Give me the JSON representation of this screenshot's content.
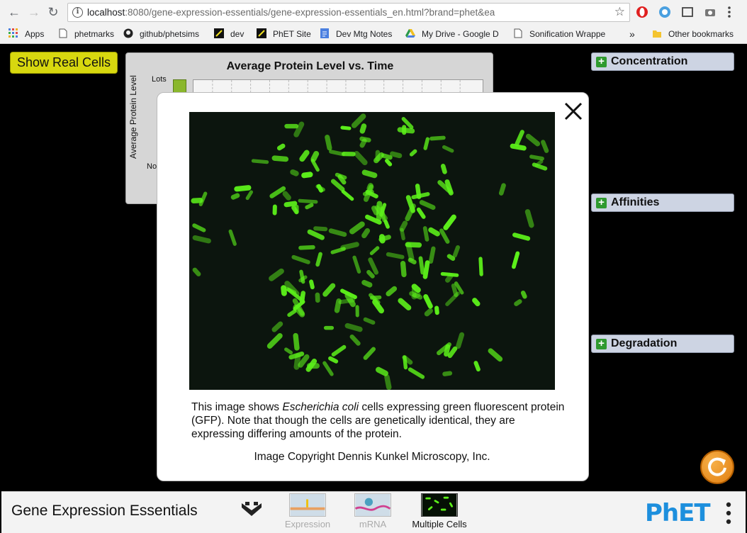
{
  "browser": {
    "url_host": "localhost",
    "url_rest": ":8080/gene-expression-essentials/gene-expression-essentials_en.html?brand=phet&ea",
    "bookmarks": [
      {
        "label": "Apps",
        "icon": "apps-grid-icon"
      },
      {
        "label": "phetmarks",
        "icon": "page-icon"
      },
      {
        "label": "github/phetsims",
        "icon": "github-icon"
      },
      {
        "label": "dev",
        "icon": "phet-icon"
      },
      {
        "label": "PhET Site",
        "icon": "phet-icon"
      },
      {
        "label": "Dev Mtg Notes",
        "icon": "docs-icon"
      },
      {
        "label": "My Drive - Google D",
        "icon": "drive-icon"
      },
      {
        "label": "Sonification Wrappe",
        "icon": "page-icon"
      }
    ],
    "overflow": "»",
    "other_bookmarks": "Other bookmarks"
  },
  "sim": {
    "show_real_cells": "Show Real Cells",
    "chart": {
      "title": "Average Protein Level vs. Time",
      "ylabel": "Average Protein Level",
      "lots_label": "Lots",
      "none_label": "No"
    },
    "panels": {
      "concentration": "Concentration",
      "affinities": "Affinities",
      "degradation": "Degradation"
    }
  },
  "dialog": {
    "caption_pre": "This image shows ",
    "caption_italic": "Escherichia coli",
    "caption_post": " cells expressing green fluorescent protein (GFP).  Note that though the cells are genetically identical, they are expressing differing amounts of the protein.",
    "copyright": "Image Copyright Dennis Kunkel Microscopy, Inc."
  },
  "navbar": {
    "title": "Gene Expression Essentials",
    "screens": [
      {
        "label": "Expression",
        "selected": false
      },
      {
        "label": "mRNA",
        "selected": false
      },
      {
        "label": "Multiple Cells",
        "selected": true
      }
    ],
    "brand": "PhET"
  },
  "colors": {
    "show_cells_button": "#d8d80f",
    "panel_background": "#cdd4e3",
    "cell_green": "#5cf01a",
    "reset_orange": "#e07d10",
    "phet_blue": "#1d8fdd"
  }
}
